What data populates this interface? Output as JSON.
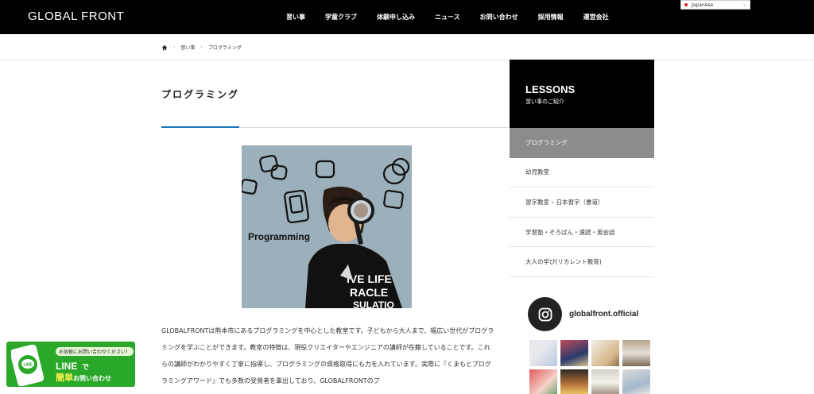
{
  "header": {
    "logo": "GLOBAL FRONT",
    "nav": [
      "習い事",
      "学童クラブ",
      "体験申し込み",
      "ニュース",
      "お問い合わせ",
      "採用情報",
      "運営会社"
    ],
    "language": "Japanese"
  },
  "breadcrumb": {
    "items": [
      "習い事",
      "プログラミング"
    ]
  },
  "main": {
    "title": "プログラミング",
    "hero_caption": "Programming",
    "hero_shirt": [
      "IVE LIFE",
      "RACLE",
      "SULATIO"
    ],
    "body": "GLOBALFRONTは熊本市にあるプログラミングを中心とした教室です。子どもから大人まで、幅広い世代がプログラミングを学ぶことができます。教室の特徴は、現役クリエイターやエンジニアの講師が在籍していることです。これらの講師がわかりやすく丁寧に指導し、プログラミングの資格取得にも力を入れています。実際に『くまもとプログラミングアワード』でも多数の受賞者を輩出しており、GLOBALFRONTのプ"
  },
  "sidebar": {
    "title": "LESSONS",
    "subtitle": "習い事のご紹介",
    "items": [
      {
        "label": "プログラミング",
        "active": true
      },
      {
        "label": "幼児教室",
        "active": false
      },
      {
        "label": "習字教室 – 日本習字（書道）",
        "active": false
      },
      {
        "label": "学習塾・そろばん・速読・英会話",
        "active": false
      },
      {
        "label": "大人の学び(リカレント教育)",
        "active": false
      }
    ],
    "instagram": "globalfront.official"
  },
  "line_banner": {
    "note": "お気軽にお問い合わせください！",
    "line": "LINE",
    "de": "で",
    "contact_big": "簡単",
    "contact_small": "お問い合わせ"
  },
  "colors": {
    "header_bg": "#000000",
    "accent": "#1e73be",
    "active_item": "#8c8c8c",
    "line_green": "#2aa82a"
  }
}
